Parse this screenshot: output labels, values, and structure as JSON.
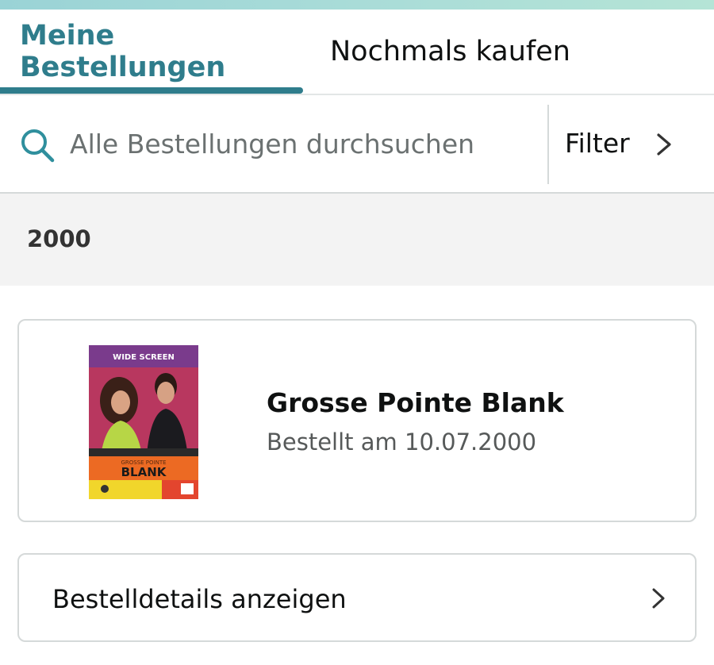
{
  "tabs": {
    "orders_label": "Meine Bestellungen",
    "buy_again_label": "Nochmals kaufen",
    "active": "orders"
  },
  "search": {
    "placeholder": "Alle Bestellungen durchsuchen",
    "value": ""
  },
  "filter": {
    "label": "Filter"
  },
  "year_group": {
    "year": "2000"
  },
  "order": {
    "title": "Grosse Pointe Blank",
    "ordered_on": "Bestellt am 10.07.2000",
    "cover": {
      "top_banner": "WIDE SCREEN",
      "title_line1": "GROSSE POINTE",
      "title_line2": "BLANK"
    }
  },
  "details_button": {
    "label": "Bestelldetails anzeigen"
  },
  "colors": {
    "accent": "#2f7d8c",
    "text": "#0f1111",
    "muted": "#565959",
    "border": "#d5d9d9",
    "band": "#f3f3f3"
  },
  "icons": {
    "search": "search-icon",
    "filter_chevron": "chevron-right-icon",
    "details_chevron": "chevron-right-icon"
  }
}
